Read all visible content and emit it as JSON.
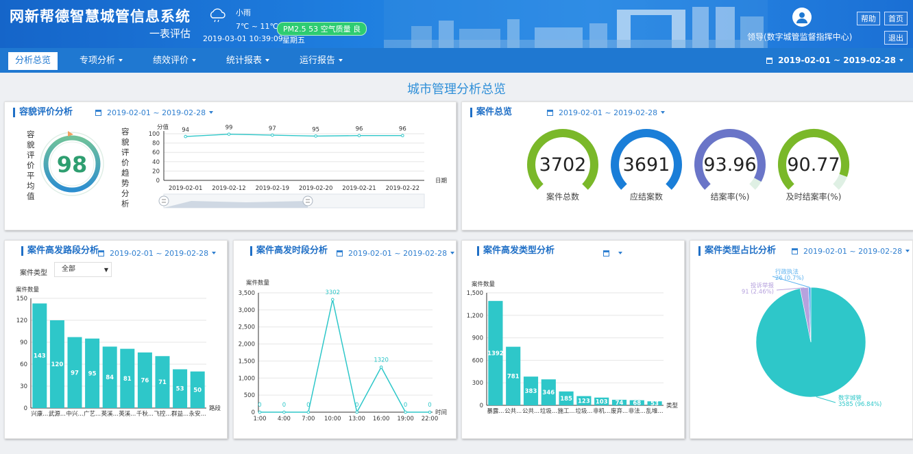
{
  "header": {
    "title": "网新帮德智慧城管信息系统",
    "subtitle": "一表评估",
    "weather": {
      "condition": "小雨",
      "temperature": "7℃ ~ 11℃",
      "pm": "PM2.5 53 空气质量 良"
    },
    "datetime": "2019-03-01 10:39:09",
    "weekday": "星期五",
    "user": "领导(数字城管监督指挥中心)",
    "help_label": "帮助",
    "home_label": "首页",
    "logout_label": "退出"
  },
  "nav": {
    "items": [
      {
        "label": "分析总览",
        "active": true
      },
      {
        "label": "专项分析",
        "dropdown": true
      },
      {
        "label": "绩效评价",
        "dropdown": true
      },
      {
        "label": "统计报表",
        "dropdown": true
      },
      {
        "label": "运行报告",
        "dropdown": true
      }
    ],
    "date_range": "2019-02-01 ~ 2019-02-28"
  },
  "page_title": "城市管理分析总览",
  "colors": {
    "brand": "#1f78d1",
    "accent": "#2ec7c9",
    "score": "#2e9e70"
  },
  "appearance": {
    "title": "容貌评价分析",
    "date_range": "2019-02-01 ~ 2019-02-28",
    "score_label": "容貌评价平均值",
    "score": 98,
    "trend_label": "容貌评价趋势分析"
  },
  "cases": {
    "title": "案件总览",
    "date_range": "2019-02-01 ~ 2019-02-28",
    "gauges": [
      {
        "label": "案件总数",
        "value": "3702",
        "fraction": 1.0,
        "color": "#7ab829"
      },
      {
        "label": "应结案数",
        "value": "3691",
        "fraction": 1.0,
        "color": "#1a7ed8"
      },
      {
        "label": "结案率(%)",
        "value": "93.96",
        "fraction": 0.9396,
        "color": "#6a75c8"
      },
      {
        "label": "及时结案率(%)",
        "value": "90.77",
        "fraction": 0.9077,
        "color": "#7ab829"
      }
    ]
  },
  "road_panel": {
    "title": "案件高发路段分析",
    "date_range": "2019-02-01 ~ 2019-02-28",
    "filter_label": "案件类型",
    "filter_value": "全部"
  },
  "time_panel": {
    "title": "案件高发时段分析",
    "date_range": "2019-02-01 ~ 2019-02-28"
  },
  "type_panel": {
    "title": "案件高发类型分析",
    "date_range": ""
  },
  "pie_panel": {
    "title": "案件类型占比分析",
    "date_range": "2019-02-01 ~ 2019-02-28"
  },
  "chart_data": [
    {
      "type": "line",
      "title": "",
      "ylabel": "分值",
      "xlabel": "日期",
      "x": [
        "2019-02-01",
        "2019-02-12",
        "2019-02-19",
        "2019-02-20",
        "2019-02-21",
        "2019-02-22"
      ],
      "values": [
        94,
        99,
        97,
        95,
        96,
        96
      ],
      "ylim": [
        0,
        100
      ],
      "yticks": [
        0,
        20,
        40,
        60,
        80,
        100
      ],
      "grid": true
    },
    {
      "type": "bar",
      "title": "",
      "ylabel": "案件数量",
      "xlabel": "路段",
      "categories": [
        "兴康...",
        "武源...",
        "中兴...",
        "广艺...",
        "英溪...",
        "英溪...",
        "千秋...",
        "飞控...",
        "群益...",
        "永安..."
      ],
      "values": [
        143,
        120,
        97,
        95,
        84,
        81,
        76,
        71,
        53,
        50
      ],
      "ylim": [
        0,
        150
      ],
      "yticks": [
        0,
        30,
        60,
        90,
        120,
        150
      ],
      "grid": true
    },
    {
      "type": "line",
      "title": "",
      "ylabel": "案件数量",
      "xlabel": "时间",
      "x": [
        "1:00",
        "4:00",
        "7:00",
        "10:00",
        "13:00",
        "16:00",
        "19:00",
        "22:00"
      ],
      "values": [
        0,
        0,
        0,
        3302,
        0,
        1320,
        0,
        0
      ],
      "ylim": [
        0,
        3500
      ],
      "yticks": [
        "0",
        "500",
        "1,000",
        "1,500",
        "2,000",
        "2,500",
        "3,000",
        "3,500"
      ],
      "grid": true
    },
    {
      "type": "bar",
      "title": "",
      "ylabel": "案件数量",
      "xlabel": "类型",
      "categories": [
        "暴露...",
        "公共...",
        "公共...",
        "垃圾...",
        "施工...",
        "垃圾...",
        "非机...",
        "废弃...",
        "非法...",
        "乱堆..."
      ],
      "values": [
        1392,
        781,
        383,
        346,
        185,
        123,
        103,
        74,
        68,
        53
      ],
      "ylim": [
        0,
        1500
      ],
      "yticks": [
        "0",
        "300",
        "600",
        "900",
        "1,200",
        "1,500"
      ],
      "grid": true
    },
    {
      "type": "pie",
      "title": "",
      "slices": [
        {
          "name": "数字城管",
          "value": 3585,
          "label": "3585 (96.84%)",
          "color": "#2ec7c9"
        },
        {
          "name": "投诉举报",
          "value": 91,
          "label": "91 (2.46%)",
          "color": "#b6a2de"
        },
        {
          "name": "行政执法",
          "value": 26,
          "label": "26 (0.7%)",
          "color": "#5ab1ef"
        }
      ]
    }
  ]
}
